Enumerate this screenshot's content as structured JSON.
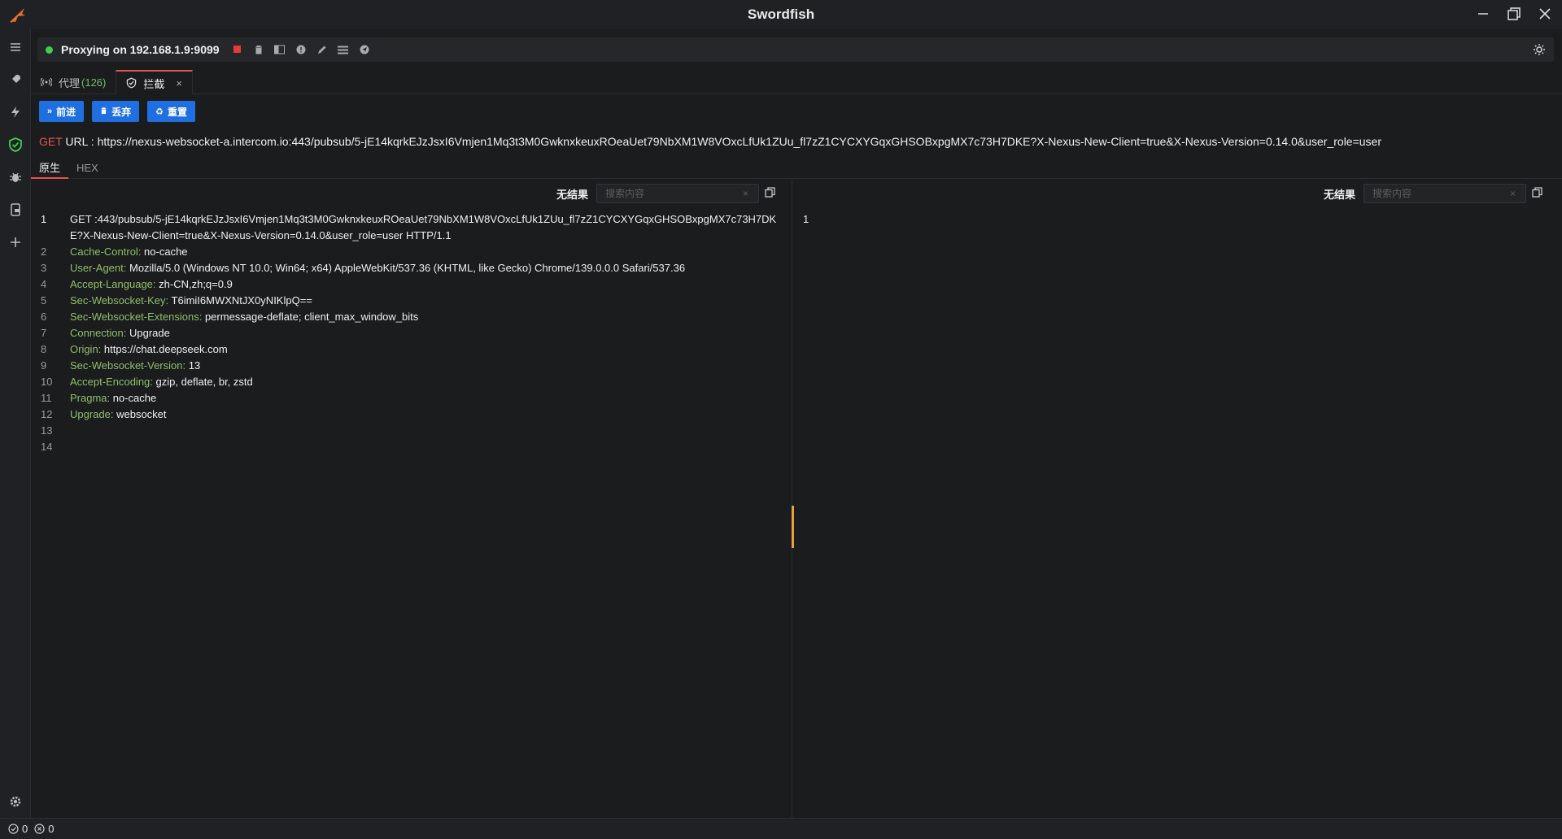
{
  "app": {
    "title": "Swordfish"
  },
  "toolbar": {
    "status_text": "Proxying on 192.168.1.9:9099",
    "status_color": "#3ecf4c",
    "icons": [
      "stop-icon",
      "trash-icon",
      "panel-icon",
      "info-icon",
      "pencil-icon",
      "list-icon",
      "send-icon",
      "sun-icon"
    ]
  },
  "tabs": [
    {
      "label": "代理",
      "count": "(126)"
    },
    {
      "label": "拦截",
      "close": "×"
    }
  ],
  "actions": {
    "forward": {
      "icon": "»",
      "label": "前进"
    },
    "discard": {
      "icon": "🗑",
      "label": "丢弃"
    },
    "reset": {
      "icon": "♻",
      "label": "重置"
    }
  },
  "request": {
    "method": "GET",
    "url_label": "URL :",
    "url": "https://nexus-websocket-a.intercom.io:443/pubsub/5-jE14kqrkEJzJsxI6Vmjen1Mq3t3M0GwknxkeuxROeaUet79NbXM1W8VOxcLfUk1ZUu_fl7zZ1CYCXYGqxGHSOBxpgMX7c73H7DKE?X-Nexus-New-Client=true&X-Nexus-Version=0.14.0&user_role=user"
  },
  "subtabs": [
    "原生",
    "HEX"
  ],
  "left_pane": {
    "no_results": "无结果",
    "search_placeholder": "搜索内容",
    "clear": "×",
    "lines": [
      {
        "n": "1",
        "key": "",
        "value": "GET :443/pubsub/5-jE14kqrkEJzJsxI6Vmjen1Mq3t3M0GwknxkeuxROeaUet79NbXM1W8VOxcLfUk1ZUu_fl7zZ1CYCXYGqxGHSOBxpgMX7c73H7DKE?X-Nexus-New-Client=true&X-Nexus-Version=0.14.0&user_role=user HTTP/1.1"
      },
      {
        "n": "2",
        "key": "Cache-Control:",
        "value": " no-cache"
      },
      {
        "n": "3",
        "key": "User-Agent:",
        "value": " Mozilla/5.0 (Windows NT 10.0; Win64; x64) AppleWebKit/537.36 (KHTML, like Gecko) Chrome/139.0.0.0 Safari/537.36"
      },
      {
        "n": "4",
        "key": "Accept-Language:",
        "value": " zh-CN,zh;q=0.9"
      },
      {
        "n": "5",
        "key": "Sec-Websocket-Key:",
        "value": " T6imiI6MWXNtJX0yNIKlpQ=="
      },
      {
        "n": "6",
        "key": "Sec-Websocket-Extensions:",
        "value": " permessage-deflate; client_max_window_bits"
      },
      {
        "n": "7",
        "key": "Connection:",
        "value": " Upgrade"
      },
      {
        "n": "8",
        "key": "Origin:",
        "value": " https://chat.deepseek.com"
      },
      {
        "n": "9",
        "key": "Sec-Websocket-Version:",
        "value": " 13"
      },
      {
        "n": "10",
        "key": "Accept-Encoding:",
        "value": " gzip, deflate, br, zstd"
      },
      {
        "n": "11",
        "key": "Pragma:",
        "value": " no-cache"
      },
      {
        "n": "12",
        "key": "Upgrade:",
        "value": " websocket"
      },
      {
        "n": "13",
        "key": "",
        "value": ""
      },
      {
        "n": "14",
        "key": "",
        "value": ""
      }
    ]
  },
  "right_pane": {
    "no_results": "无结果",
    "search_placeholder": "搜索内容",
    "clear": "×",
    "lines": [
      {
        "n": "1",
        "key": "",
        "value": ""
      }
    ]
  },
  "statusbar": {
    "ok_count": "0",
    "err_count": "0"
  },
  "colors": {
    "accent_red": "#e55353",
    "button_blue": "#1f6fe0",
    "header_key": "#8fbf6a",
    "divider_handle": "#e8a13a"
  }
}
